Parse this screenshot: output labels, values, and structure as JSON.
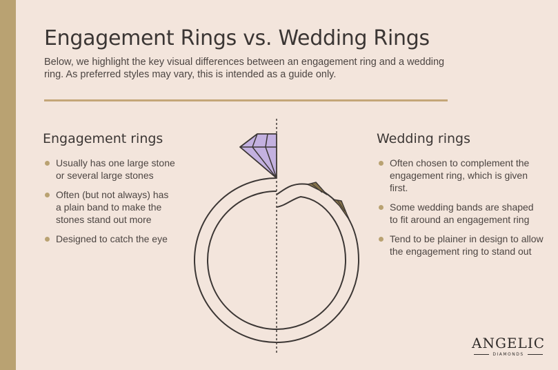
{
  "header": {
    "title": "Engagement Rings vs. Wedding Rings",
    "subtitle": "Below, we highlight the key visual differences between an engagement ring and a wedding ring. As preferred styles may vary, this is intended as a guide only."
  },
  "engagement": {
    "title": "Engagement rings",
    "points": [
      "Usually has one large stone or several large stones",
      "Often (but not always) has a plain band to make the stones stand out more",
      "Designed to catch the eye"
    ]
  },
  "wedding": {
    "title": "Wedding rings",
    "points": [
      "Often chosen to complement the engagement ring, which is given first.",
      "Some wedding bands are shaped to fit around an engagement ring",
      "Tend to be plainer in design to allow the engagement ring to stand out"
    ]
  },
  "logo": {
    "name": "ANGELIC",
    "sub": "DIAMONDS"
  },
  "colors": {
    "background": "#f3e5dc",
    "accent": "#b9a272",
    "gem": "#c3b1e0",
    "band_stones": "#857249",
    "text": "#3b3634"
  }
}
